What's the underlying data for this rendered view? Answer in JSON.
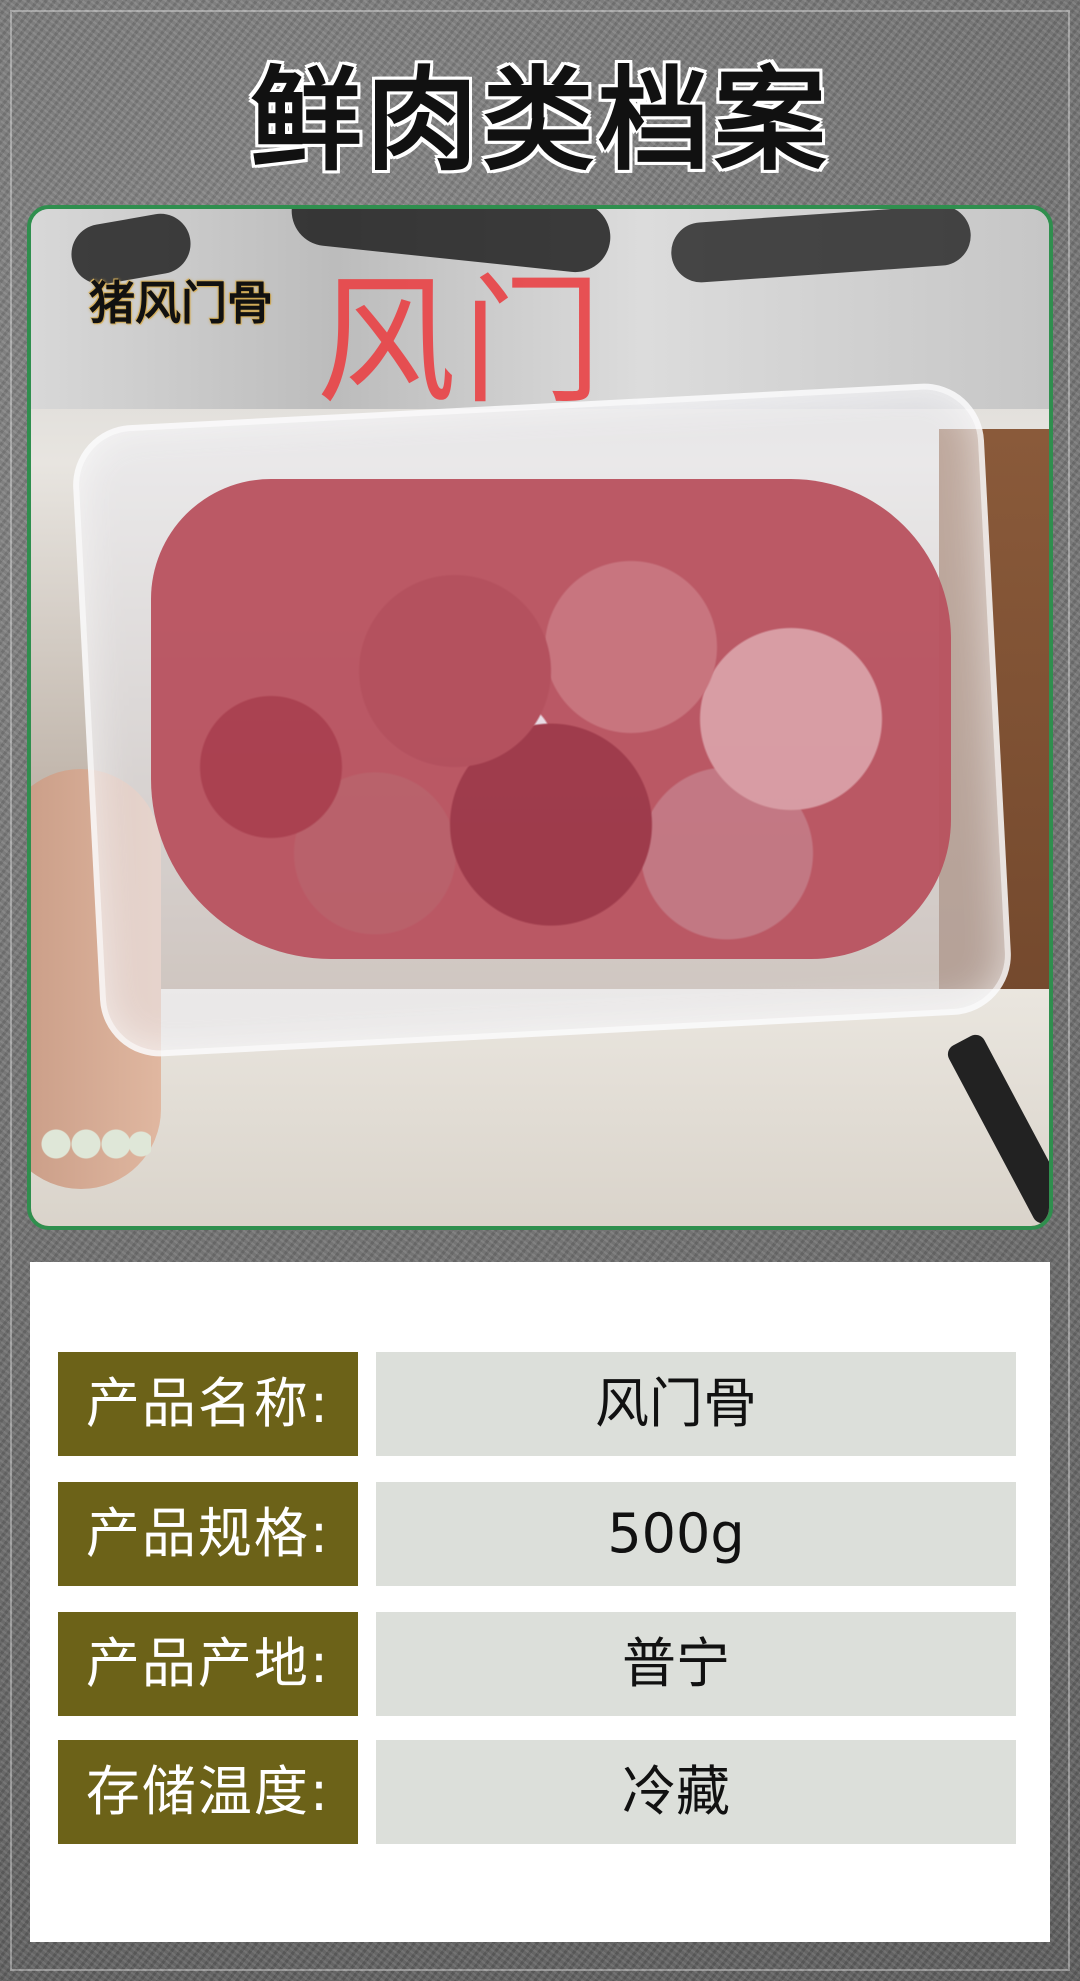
{
  "header": {
    "title": "鲜肉类档案"
  },
  "photo": {
    "overlay_small": "猪风门骨",
    "overlay_large": "风门"
  },
  "specs": [
    {
      "key": "产品名称:",
      "value": "风门骨"
    },
    {
      "key": "产品规格:",
      "value": "500g"
    },
    {
      "key": "产品产地:",
      "value": "普宁"
    },
    {
      "key": "存储温度:",
      "value": "冷藏"
    }
  ],
  "colors": {
    "label_bg": "#6c6218",
    "value_bg": "#dcdfda",
    "photo_border": "#2f8f4e",
    "overlay_red": "#e84448"
  }
}
